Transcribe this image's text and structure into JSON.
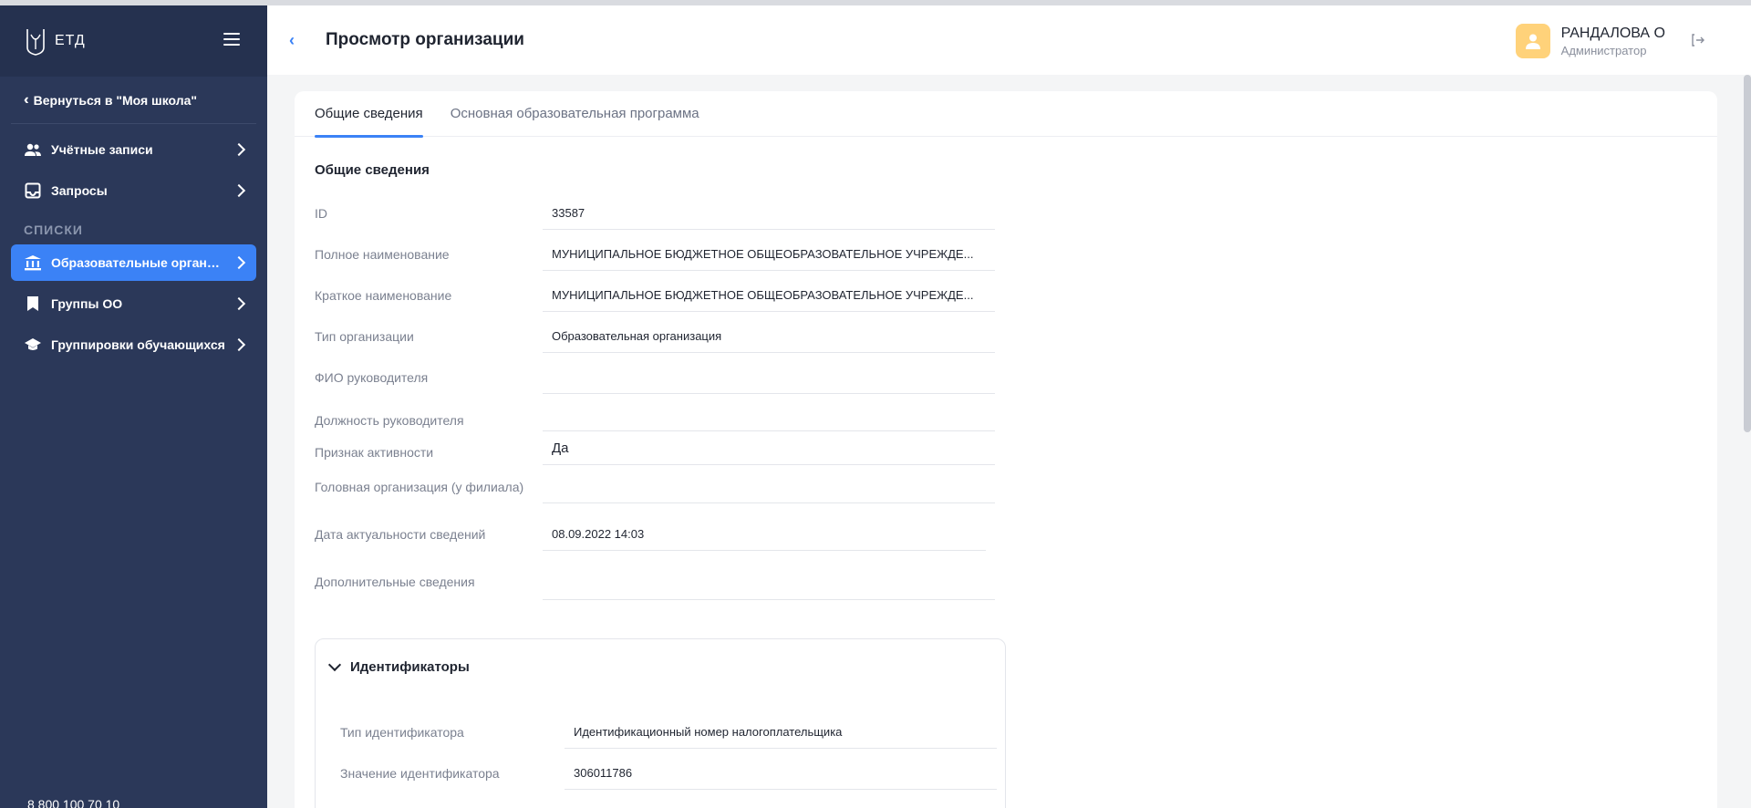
{
  "app": {
    "logo_text": "ЕТД"
  },
  "sidebar": {
    "back_label": "Вернуться в \"Моя школа\"",
    "items_top": [
      {
        "label": "Учётные записи",
        "icon": "users-icon"
      },
      {
        "label": "Запросы",
        "icon": "inbox-icon"
      }
    ],
    "section_title": "СПИСКИ",
    "items_lists": [
      {
        "label": "Образовательные организа...",
        "icon": "bank-icon",
        "active": true
      },
      {
        "label": "Группы ОО",
        "icon": "bookmark-icon"
      },
      {
        "label": "Группировки обучающихся",
        "icon": "graduation-cap-icon"
      }
    ],
    "phone": "8 800 100 70 10"
  },
  "header": {
    "title": "Просмотр организации",
    "user_name": "РАНДАЛОВА О",
    "user_role": "Администратор"
  },
  "tabs": [
    {
      "label": "Общие сведения",
      "active": true
    },
    {
      "label": "Основная образовательная программа",
      "active": false
    }
  ],
  "general": {
    "section_title": "Общие сведения",
    "fields": [
      {
        "label": "ID",
        "value": "33587"
      },
      {
        "label": "Полное наименование",
        "value": "МУНИЦИПАЛЬНОЕ БЮДЖЕТНОЕ ОБЩЕОБРАЗОВАТЕЛЬНОЕ УЧРЕЖДЕ..."
      },
      {
        "label": "Краткое наименование",
        "value": "МУНИЦИПАЛЬНОЕ БЮДЖЕТНОЕ ОБЩЕОБРАЗОВАТЕЛЬНОЕ УЧРЕЖДЕ..."
      },
      {
        "label": "Тип организации",
        "value": "Образовательная организация"
      },
      {
        "label": "ФИО руководителя",
        "value": ""
      },
      {
        "label": "Должность руководителя",
        "value": ""
      },
      {
        "label": "Признак активности",
        "value": "Да"
      },
      {
        "label": "Головная организация (у филиала)",
        "value": ""
      },
      {
        "label": "Дата актуальности сведений",
        "value": "08.09.2022 14:03"
      },
      {
        "label": "Дополнительные сведения",
        "value": ""
      }
    ]
  },
  "identifiers": {
    "title": "Идентификаторы",
    "fields": [
      {
        "label": "Тип идентификатора",
        "value": "Идентификационный номер налогоплательщика"
      },
      {
        "label": "Значение идентификатора",
        "value": "306011786"
      }
    ]
  },
  "colors": {
    "sidebar": "#2b3859",
    "accent": "#3b82f6",
    "avatar": "#ffd27a"
  }
}
